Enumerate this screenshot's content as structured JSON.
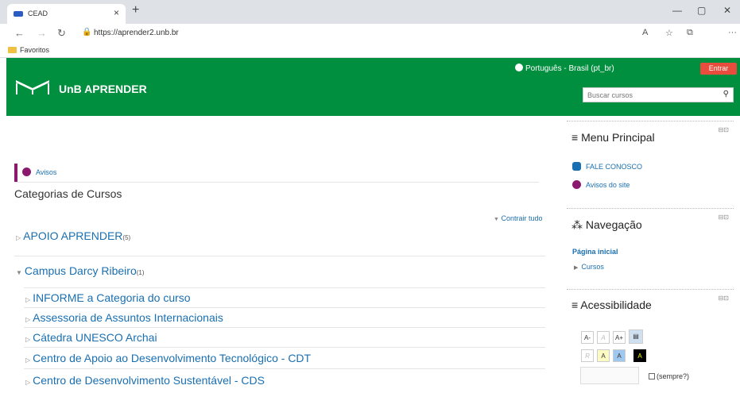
{
  "browser": {
    "tab_title": "CEAD",
    "tab_close": "×",
    "new_tab": "+",
    "url": "https://aprender2.unb.br",
    "favorites_label": "Favoritos"
  },
  "header": {
    "language": "Português - Brasil (pt_br)",
    "login_label": "Entrar",
    "brand": "UnB APRENDER",
    "search_placeholder": "Buscar cursos"
  },
  "main": {
    "avisos_label": "Avisos",
    "categories_title": "Categorias de Cursos",
    "collapse_all": "Contrair tudo",
    "top_categories": [
      {
        "name": "APOIO APRENDER",
        "count": "(5)"
      },
      {
        "name": "Campus Darcy Ribeiro",
        "count": "(1)"
      }
    ],
    "subcategories": [
      "INFORME a Categoria do curso",
      "Assessoria de Assuntos Internacionais",
      "Cátedra UNESCO Archai",
      "Centro de Apoio ao Desenvolvimento Tecnológico - CDT",
      "Centro de Desenvolvimento Sustentável - CDS"
    ]
  },
  "sidebar": {
    "main_menu": {
      "title": "Menu Principal",
      "items": [
        "FALE CONOSCO",
        "Avisos do site"
      ]
    },
    "navigation": {
      "title": "Navegação",
      "home": "Página inicial",
      "courses": "Cursos"
    },
    "accessibility": {
      "title": "Acessibilidade",
      "row1": [
        "A-",
        "A",
        "A+"
      ],
      "row2": [
        "R",
        "A",
        "A",
        "A"
      ],
      "always_label": "(sempre?)"
    }
  },
  "colors": {
    "header_green": "#008f3e",
    "login_red": "#e74c3c",
    "link_blue": "#1a6fb0"
  }
}
